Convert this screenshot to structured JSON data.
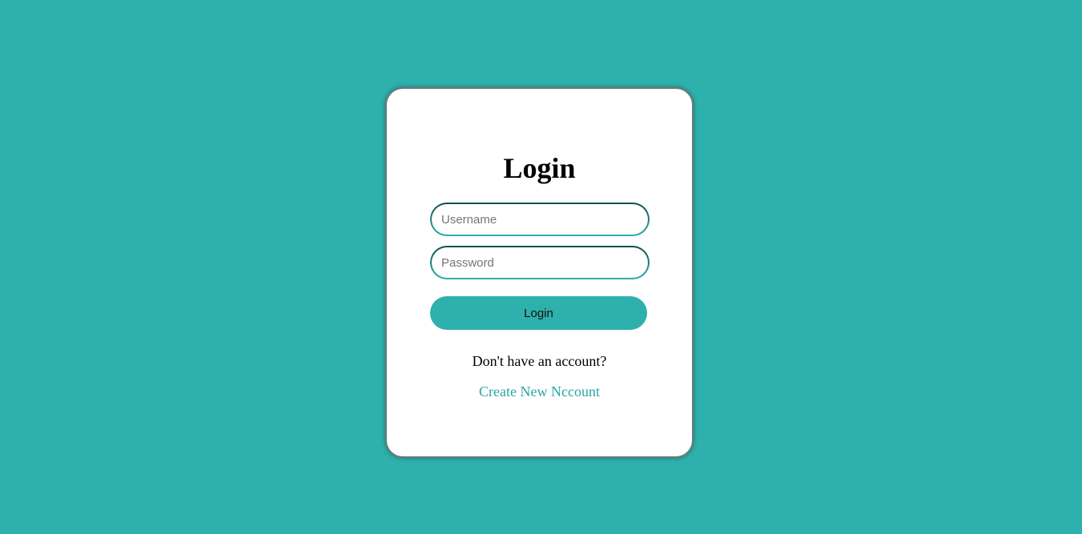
{
  "theme": {
    "background": "#2eb0ac",
    "accent": "#2eb0ac",
    "card_background": "#ffffff",
    "link_color": "#2aa6a2"
  },
  "login_card": {
    "title": "Login",
    "username": {
      "placeholder": "Username",
      "value": ""
    },
    "password": {
      "placeholder": "Password",
      "value": ""
    },
    "submit_label": "Login",
    "signup_prompt": "Don't have an account?",
    "signup_link": "Create New Nccount"
  }
}
